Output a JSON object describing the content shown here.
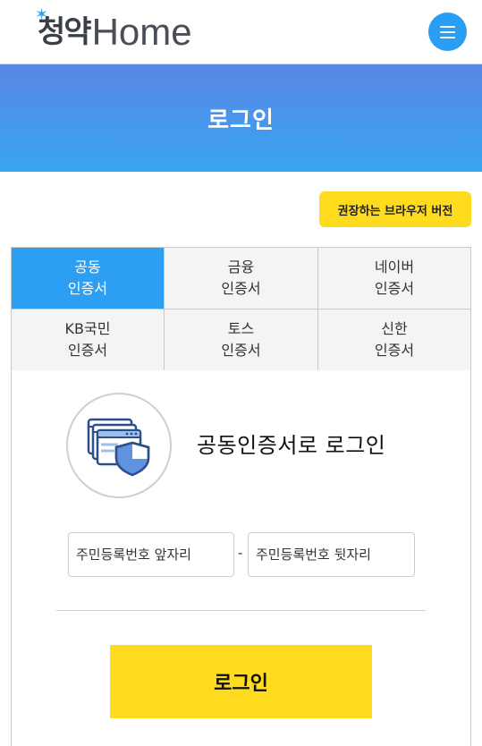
{
  "header": {
    "logo_text": "청약",
    "logo_home": "Home",
    "logo_star": "✶",
    "menu_icon": "hamburger-menu-icon"
  },
  "banner": {
    "title": "로그인"
  },
  "browser_button": {
    "label": "권장하는 브라우저 버전"
  },
  "tabs": [
    {
      "line1": "공동",
      "line2": "인증서",
      "active": true
    },
    {
      "line1": "금융",
      "line2": "인증서",
      "active": false
    },
    {
      "line1": "네이버",
      "line2": "인증서",
      "active": false
    },
    {
      "line1": "KB국민",
      "line2": "인증서",
      "active": false
    },
    {
      "line1": "토스",
      "line2": "인증서",
      "active": false
    },
    {
      "line1": "신한",
      "line2": "인증서",
      "active": false
    }
  ],
  "panel": {
    "icon": "certificate-shield-icon",
    "heading": "공동인증서로 로그인",
    "id_front_placeholder": "주민등록번호 앞자리",
    "id_back_placeholder": "주민등록번호 뒷자리",
    "separator": "-",
    "login_label": "로그인"
  },
  "colors": {
    "accent_blue": "#2d9ff3",
    "banner_top": "#5b86e5",
    "banner_bottom": "#37a5f2",
    "yellow": "#ffdb1f"
  }
}
